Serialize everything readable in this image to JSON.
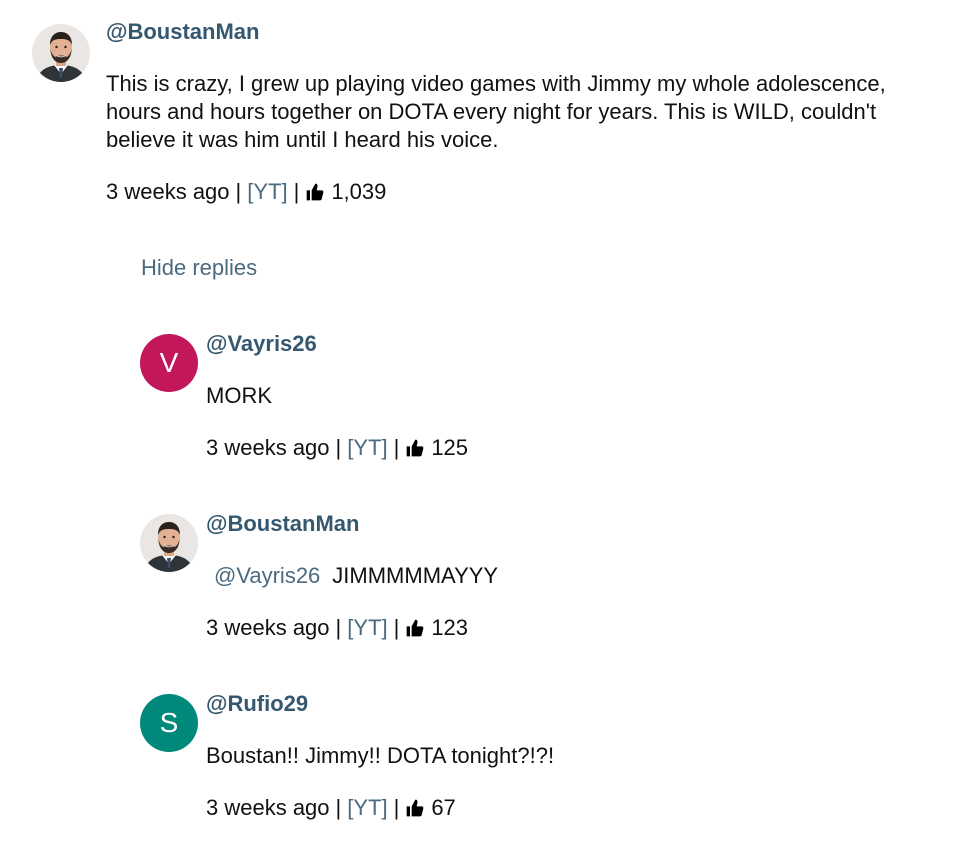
{
  "comments": [
    {
      "author": "@BoustanMan",
      "text": "This is crazy, I grew up playing video games with Jimmy my whole adolescence, hours and hours together on DOTA every night for years. This is WILD, couldn't believe it was him until I heard his voice.",
      "time": "3 weeks ago",
      "source": "[YT]",
      "likes": "1,039",
      "avatar": "photo"
    }
  ],
  "hide_replies_label": "Hide replies",
  "replies": [
    {
      "author": "@Vayris26",
      "avatar_letter": "V",
      "avatar_color": "#c2185b",
      "text": "MORK",
      "time": "3 weeks ago",
      "source": "[YT]",
      "likes": "125"
    },
    {
      "author": "@BoustanMan",
      "avatar": "photo",
      "mention": "@Vayris26",
      "text": "JIMMMMMAYYY",
      "time": "3 weeks ago",
      "source": "[YT]",
      "likes": "123"
    },
    {
      "author": "@Rufio29",
      "avatar_letter": "S",
      "avatar_color": "#00897b",
      "text": "Boustan!! Jimmy!! DOTA tonight?!?!",
      "time": "3 weeks ago",
      "source": "[YT]",
      "likes": "67"
    }
  ],
  "colors": {
    "author": "#36586f",
    "link": "#4a6a80"
  },
  "icons": {
    "like": "thumbs-up-icon"
  }
}
